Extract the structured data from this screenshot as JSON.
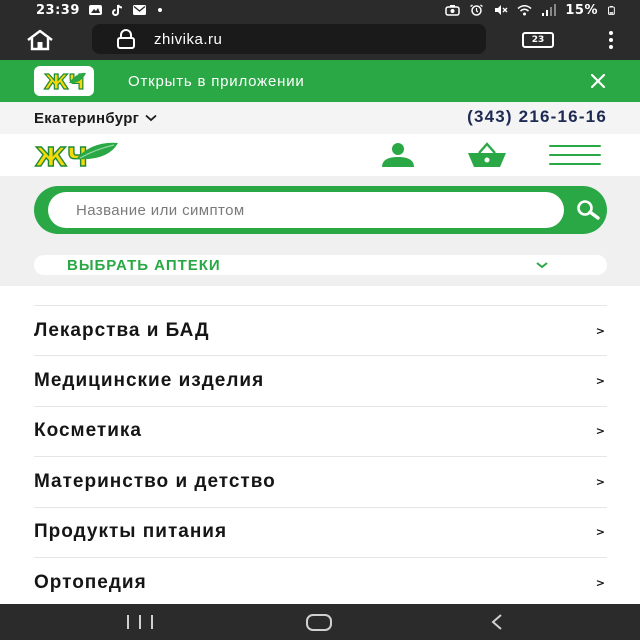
{
  "status_bar": {
    "time": "23:39",
    "battery": "15%",
    "icons": [
      "gallery-icon",
      "tiktok-icon",
      "mail-icon",
      "dot-icon",
      "camera-icon",
      "alarm-icon",
      "mute-icon",
      "wifi-icon",
      "signal-icon",
      "battery-icon"
    ]
  },
  "browser": {
    "url": "zhivika.ru",
    "tab_count": "23",
    "icons": [
      "home-icon",
      "lock-icon",
      "more-vertical-icon"
    ]
  },
  "app_banner": {
    "logo_text": "ЖЧ",
    "label": "Открыть в приложении",
    "close_icon": "close-icon"
  },
  "location": {
    "city": "Екатеринбург",
    "phone": "(343) 216-16-16"
  },
  "header": {
    "logo_text": "ЖЧ",
    "icons": [
      "user-icon",
      "basket-icon",
      "burger-menu-icon"
    ]
  },
  "search": {
    "placeholder": "Название или симптом",
    "button_icon": "search-icon"
  },
  "pharmacy_select": {
    "label": "ВЫБРАТЬ АПТЕКИ"
  },
  "categories": [
    {
      "label": "Лекарства и БАД",
      "arrow": ">"
    },
    {
      "label": "Медицинские изделия",
      "arrow": ">"
    },
    {
      "label": "Косметика",
      "arrow": ">"
    },
    {
      "label": "Материнство и детство",
      "arrow": ">"
    },
    {
      "label": "Продукты питания",
      "arrow": ">"
    },
    {
      "label": "Ортопедия",
      "arrow": ">"
    }
  ],
  "colors": {
    "brand_green": "#2aa845",
    "logo_yellow": "#f5d90a",
    "phone_navy": "#1d2a54",
    "system_bar": "#2b2b2b"
  }
}
